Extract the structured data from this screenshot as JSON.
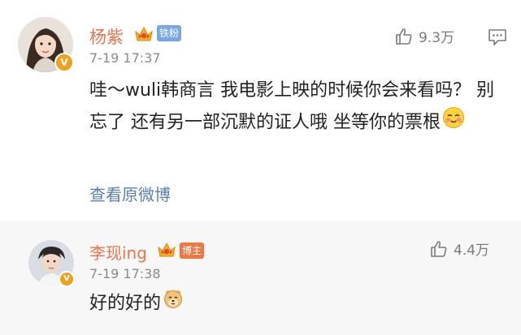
{
  "comments": [
    {
      "name": "杨紫",
      "tag": "铁粉",
      "time": "7-19 17:37",
      "likes": "9.3万",
      "text": "哇～wuli韩商言 我电影上映的时候你会来看吗？ 别忘了 还有另一部沉默的证人哦 坐等你的票根",
      "link": "查看原微博",
      "verified": "V"
    },
    {
      "name": "李现ing",
      "tag": "博主",
      "time": "7-19 17:38",
      "likes": "4.4万",
      "text": "好的好的",
      "verified": "V"
    }
  ],
  "colors": {
    "name": "#eb7350",
    "link": "#5b7fb0",
    "fan_tag": "#79a7e6",
    "host_tag": "#f07840",
    "verified": "#f0a01c"
  },
  "icons": [
    "thumbs-up-icon",
    "reply-icon",
    "crown-icon",
    "blush-emoji",
    "dog-emoji"
  ]
}
